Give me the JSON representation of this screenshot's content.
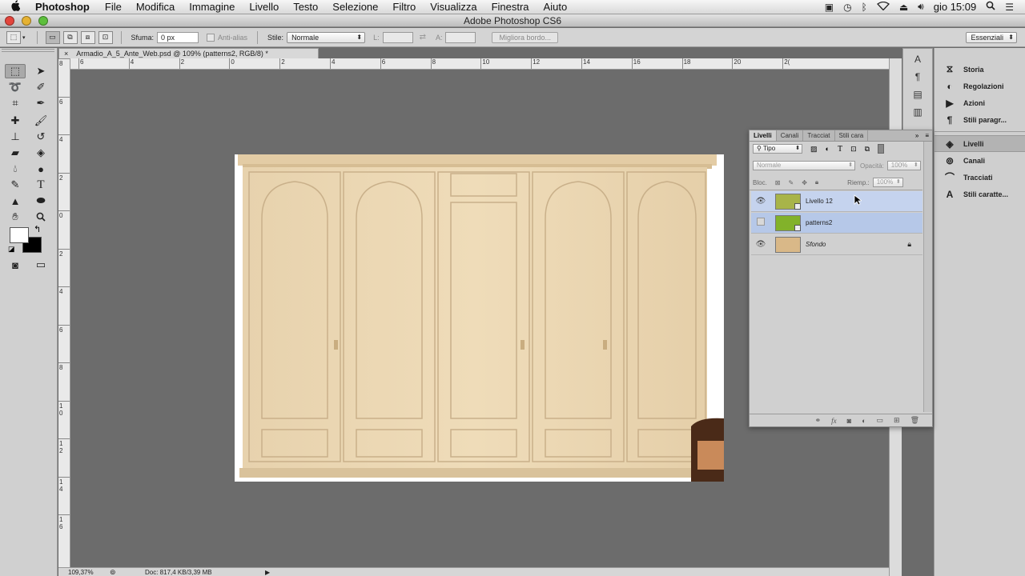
{
  "menubar": {
    "apple": "",
    "app_name": "Photoshop",
    "items": [
      "File",
      "Modifica",
      "Immagine",
      "Livello",
      "Testo",
      "Selezione",
      "Filtro",
      "Visualizza",
      "Finestra",
      "Aiuto"
    ],
    "clock": "gio 15:09"
  },
  "window": {
    "title": "Adobe Photoshop CS6"
  },
  "options": {
    "feather_label": "Sfuma:",
    "feather_value": "0 px",
    "antialias_label": "Anti-alias",
    "style_label": "Stile:",
    "style_value": "Normale",
    "width_label": "L:",
    "height_label": "A:",
    "refine_button": "Migliora bordo...",
    "workspace": "Essenziali"
  },
  "document": {
    "tab_title": "Armadio_A_5_Ante_Web.psd @ 109% (patterns2, RGB/8) *",
    "zoom": "109,37%",
    "doc_info": "Doc: 817,4 KB/3,39 MB"
  },
  "ruler": {
    "h_labels": [
      "6",
      "4",
      "2",
      "0",
      "2",
      "4",
      "6",
      "8",
      "10",
      "12",
      "14",
      "16",
      "18",
      "20",
      "2("
    ],
    "v_labels": [
      "8",
      "6",
      "4",
      "2",
      "0",
      "2",
      "4",
      "6",
      "8",
      "1 0",
      "1 2",
      "1 4",
      "1 6"
    ]
  },
  "layers_panel": {
    "tabs": [
      "Livelli",
      "Canali",
      "Tracciat",
      "Stili cara"
    ],
    "filter_value": "Tipo",
    "blend_mode": "Normale",
    "opacity_label": "Opacità:",
    "opacity_value": "100%",
    "lock_label": "Bloc.",
    "fill_label": "Riemp.:",
    "fill_value": "100%",
    "layers": [
      {
        "name": "Livello 12",
        "visible": true,
        "thumb_color": "#a8b449",
        "italic": false
      },
      {
        "name": "patterns2",
        "visible": false,
        "thumb_color": "#82b22a",
        "italic": false
      },
      {
        "name": "Sfondo",
        "visible": true,
        "thumb_color": "#d9b888",
        "italic": true,
        "locked": true
      }
    ]
  },
  "dock": {
    "items": [
      "Storia",
      "Regolazioni",
      "Azioni",
      "Stili paragr...",
      "Livelli",
      "Canali",
      "Tracciati",
      "Stili caratte..."
    ],
    "active": "Livelli"
  },
  "colors": {
    "foreground": "#ffffff",
    "background": "#000000",
    "wardrobe": "#e8d3ae"
  }
}
